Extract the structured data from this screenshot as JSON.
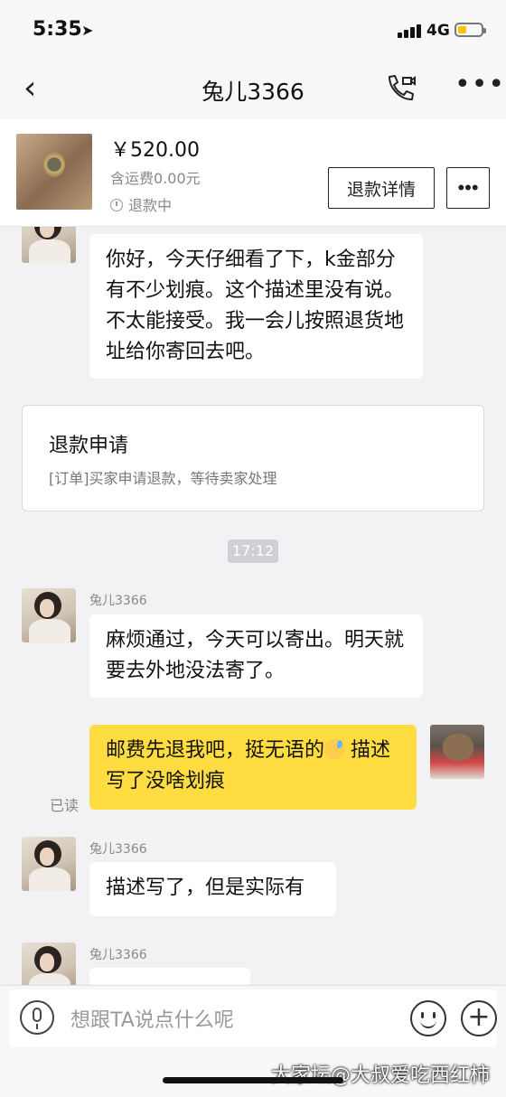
{
  "status_bar": {
    "time": "5:35",
    "network": "4G"
  },
  "header": {
    "title": "兔儿3366"
  },
  "product": {
    "price": "￥520.00",
    "shipping": "含运费0.00元",
    "status": "退款中",
    "refund_detail_button": "退款详情"
  },
  "messages": {
    "m1": {
      "text": "你好，今天仔细看了下，k金部分有不少划痕。这个描述里没有说。不太能接受。我一会儿按照退货地址给你寄回去吧。"
    },
    "card": {
      "title": "退款申请",
      "desc": "[订单]买家申请退款，等待卖家处理"
    },
    "timestamp": "17:12",
    "m2": {
      "sender": "兔儿3366",
      "text": "麻烦通过，今天可以寄出。明天就要去外地没法寄了。"
    },
    "m3": {
      "text_before": "邮费先退我吧，挺无语的",
      "text_after": " 描述写了没啥划痕",
      "read": "已读"
    },
    "m4": {
      "sender": "兔儿3366",
      "text": "描述写了，但是实际有"
    },
    "m5": {
      "sender": "兔儿3366"
    }
  },
  "input_bar": {
    "placeholder": "想跟TA说点什么呢"
  },
  "watermark": "大家坛@大叔爱吃西红柿"
}
